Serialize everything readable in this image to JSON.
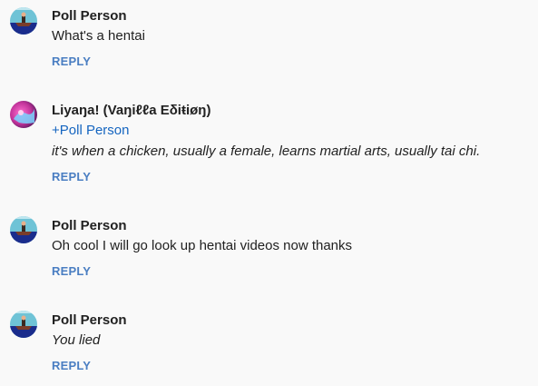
{
  "comments": [
    {
      "author": "Poll Person",
      "avatar": "poll-person-avatar",
      "text": "What's a hentai",
      "reply_label": "REPLY"
    },
    {
      "author": "Liyaŋa! (Vaŋiℓℓa Eδiŧiøŋ)",
      "avatar": "liyana-avatar",
      "mention": "+Poll Person",
      "text": "it's when a chicken, usually a female, learns martial arts, usually tai chi.",
      "reply_label": "REPLY"
    },
    {
      "author": "Poll Person",
      "avatar": "poll-person-avatar",
      "text": "Oh cool I will go look up hentai videos now thanks",
      "reply_label": "REPLY"
    },
    {
      "author": "Poll Person",
      "avatar": "poll-person-avatar",
      "text": "You lied",
      "reply_label": "REPLY"
    }
  ],
  "colors": {
    "background": "#f9f9f9",
    "reply_link": "#4a7ec2",
    "mention_link": "#1565c0",
    "text": "#212121"
  }
}
